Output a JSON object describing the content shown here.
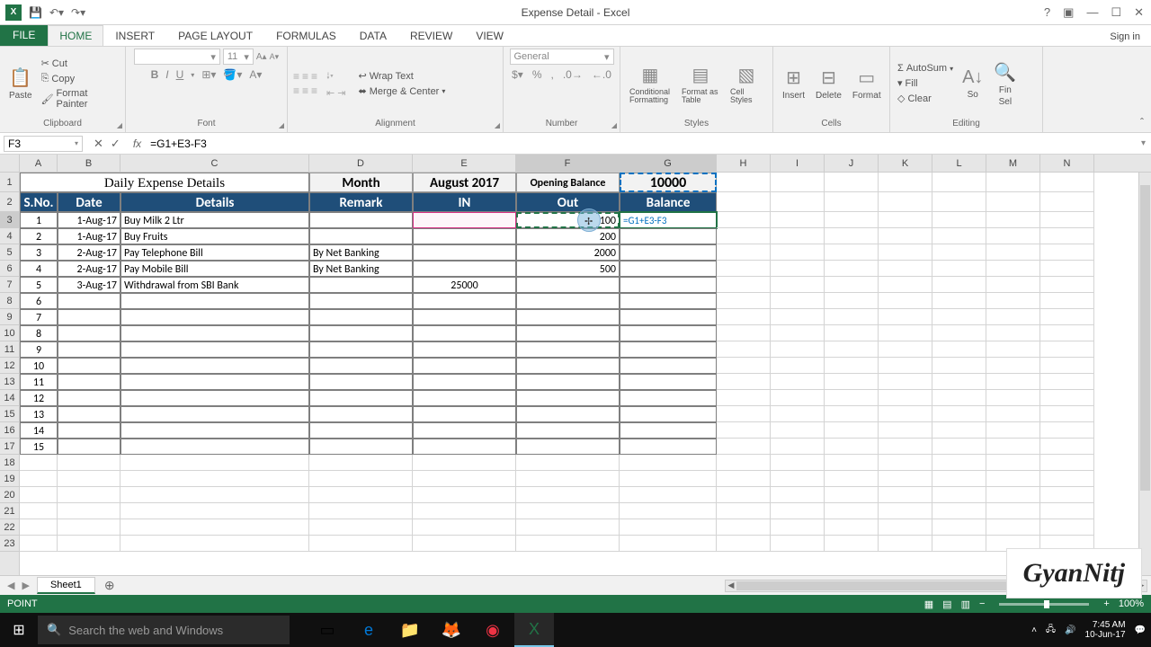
{
  "titlebar": {
    "title": "Expense Detail - Excel"
  },
  "ribbon_tabs": {
    "file": "FILE",
    "home": "HOME",
    "insert": "INSERT",
    "page_layout": "PAGE LAYOUT",
    "formulas": "FORMULAS",
    "data": "DATA",
    "review": "REVIEW",
    "view": "VIEW",
    "signin": "Sign in"
  },
  "ribbon": {
    "clipboard": {
      "paste": "Paste",
      "cut": "Cut",
      "copy": "Copy",
      "painter": "Format Painter",
      "label": "Clipboard"
    },
    "font": {
      "name": "",
      "size": "11",
      "label": "Font"
    },
    "alignment": {
      "wrap": "Wrap Text",
      "merge": "Merge & Center",
      "label": "Alignment"
    },
    "number": {
      "format": "General",
      "label": "Number"
    },
    "styles": {
      "cond": "Conditional Formatting",
      "table": "Format as Table",
      "cell": "Cell Styles",
      "label": "Styles"
    },
    "cells": {
      "insert": "Insert",
      "delete": "Delete",
      "format": "Format",
      "label": "Cells"
    },
    "editing": {
      "autosum": "AutoSum",
      "fill": "Fill",
      "clear": "Clear",
      "sort": "So",
      "find": "Fin",
      "sel": "Sel",
      "label": "Editing"
    }
  },
  "formula_bar": {
    "name_box": "F3",
    "formula": "=G1+E3-F3"
  },
  "columns": [
    "A",
    "B",
    "C",
    "D",
    "E",
    "F",
    "G",
    "H",
    "I",
    "J",
    "K",
    "L",
    "M",
    "N"
  ],
  "sheet": {
    "title": "Daily Expense Details",
    "month_label": "Month",
    "month_value": "August 2017",
    "opening_label": "Opening Balance",
    "opening_value": "10000",
    "headers": {
      "sno": "S.No.",
      "date": "Date",
      "details": "Details",
      "remark": "Remark",
      "in": "IN",
      "out": "Out",
      "balance": "Balance"
    },
    "rows": [
      {
        "n": "1",
        "date": "1-Aug-17",
        "details": "Buy Milk 2 Ltr",
        "remark": "",
        "in": "",
        "out": "100",
        "balance": "=G1+E3-F3"
      },
      {
        "n": "2",
        "date": "1-Aug-17",
        "details": "Buy Fruits",
        "remark": "",
        "in": "",
        "out": "200",
        "balance": ""
      },
      {
        "n": "3",
        "date": "2-Aug-17",
        "details": "Pay Telephone Bill",
        "remark": "By Net Banking",
        "in": "",
        "out": "2000",
        "balance": ""
      },
      {
        "n": "4",
        "date": "2-Aug-17",
        "details": "Pay Mobile Bill",
        "remark": "By Net Banking",
        "in": "",
        "out": "500",
        "balance": ""
      },
      {
        "n": "5",
        "date": "3-Aug-17",
        "details": "Withdrawal from SBI Bank",
        "remark": "",
        "in": "25000",
        "out": "",
        "balance": ""
      },
      {
        "n": "6"
      },
      {
        "n": "7"
      },
      {
        "n": "8"
      },
      {
        "n": "9"
      },
      {
        "n": "10"
      },
      {
        "n": "11"
      },
      {
        "n": "12"
      },
      {
        "n": "13"
      },
      {
        "n": "14"
      },
      {
        "n": "15"
      }
    ]
  },
  "sheet_tab": "Sheet1",
  "status": {
    "mode": "POINT",
    "zoom": "100%"
  },
  "watermark": "GyanNitj",
  "taskbar": {
    "search_placeholder": "Search the web and Windows",
    "time": "7:45 AM",
    "date": "10-Jun-17"
  }
}
